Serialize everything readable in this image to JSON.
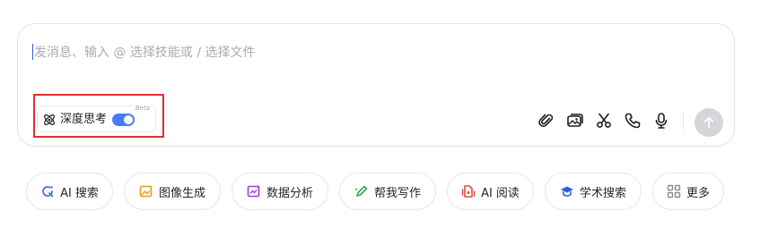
{
  "composer": {
    "placeholder": "发消息、输入 @ 选择技能或 / 选择文件"
  },
  "deep_think": {
    "label": "深度思考",
    "badge": "Beta",
    "enabled": true
  },
  "toolbar": {
    "icons": [
      "paperclip-icon",
      "image-icon",
      "scissors-icon",
      "phone-icon",
      "microphone-icon"
    ],
    "send_icon": "arrow-up-icon"
  },
  "chips": [
    {
      "label": "AI 搜索",
      "icon": "search-refresh-icon",
      "color": "#3b6fe0"
    },
    {
      "label": "图像生成",
      "icon": "image-gen-icon",
      "color": "#e0a21c"
    },
    {
      "label": "数据分析",
      "icon": "data-chart-icon",
      "color": "#9b3fd0"
    },
    {
      "label": "帮我写作",
      "icon": "pen-icon",
      "color": "#2fa84f"
    },
    {
      "label": "AI 阅读",
      "icon": "reading-icon",
      "color": "#e24a3b"
    },
    {
      "label": "学术搜索",
      "icon": "graduation-cap-icon",
      "color": "#2c63d8"
    },
    {
      "label": "更多",
      "icon": "grid-icon",
      "color": "#8a8a8f"
    }
  ],
  "colors": {
    "accent": "#4a7bf7",
    "highlight_border": "#e0312b",
    "send_disabled": "#d6d6da"
  }
}
